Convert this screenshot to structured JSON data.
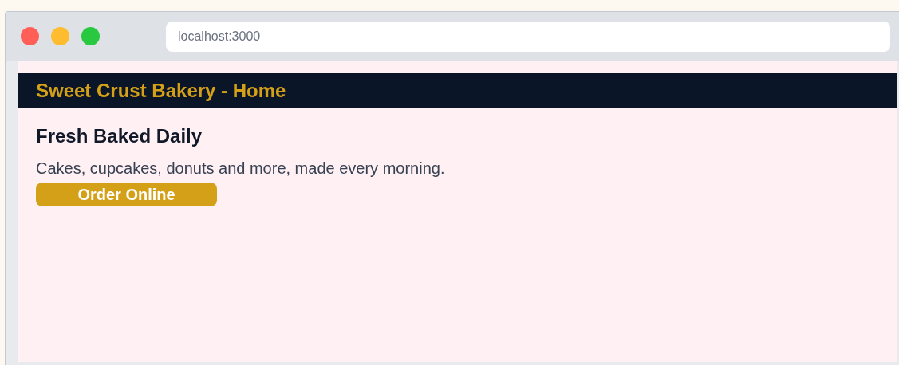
{
  "browser": {
    "address": "localhost:3000"
  },
  "header": {
    "title": "Sweet Crust Bakery - Home"
  },
  "hero": {
    "heading": "Fresh Baked Daily",
    "text": "Cakes, cupcakes, donuts and more, made every morning.",
    "button": "Order Online"
  }
}
